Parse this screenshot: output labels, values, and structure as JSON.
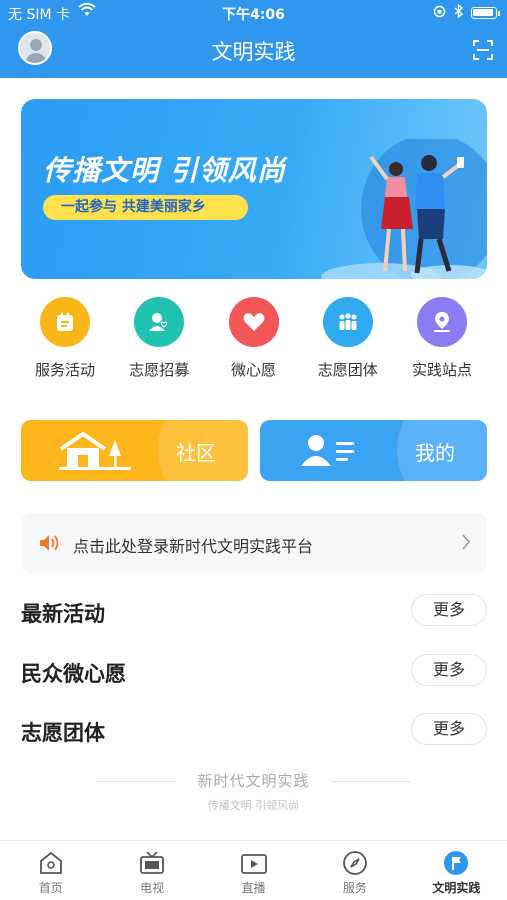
{
  "status_bar": {
    "carrier": "无 SIM 卡",
    "time": "下午4:06"
  },
  "header": {
    "title": "文明实践"
  },
  "banner": {
    "headline": "传播文明 引领风尚",
    "tagline": "一起参与 共建美丽家乡"
  },
  "quick_links": [
    {
      "label": "服务活动",
      "color": "#f9b619",
      "icon": "calendar-icon"
    },
    {
      "label": "志愿招募",
      "color": "#1fc3b0",
      "icon": "user-heart-icon"
    },
    {
      "label": "微心愿",
      "color": "#f25656",
      "icon": "heart-icon"
    },
    {
      "label": "志愿团体",
      "color": "#2fa9f0",
      "icon": "group-icon"
    },
    {
      "label": "实践站点",
      "color": "#8c7cf2",
      "icon": "location-icon"
    }
  ],
  "cards": {
    "community": "社区",
    "mine": "我的"
  },
  "notice": {
    "text": "点击此处登录新时代文明实践平台"
  },
  "sections": [
    {
      "title": "最新活动",
      "more": "更多"
    },
    {
      "title": "民众微心愿",
      "more": "更多"
    },
    {
      "title": "志愿团体",
      "more": "更多"
    }
  ],
  "slogan": {
    "title": "新时代文明实践",
    "subtitle": "传播文明 引领风尚"
  },
  "tabs": [
    {
      "label": "首页",
      "icon": "home-icon"
    },
    {
      "label": "电视",
      "icon": "tv-icon"
    },
    {
      "label": "直播",
      "icon": "live-icon"
    },
    {
      "label": "服务",
      "icon": "compass-icon"
    },
    {
      "label": "文明实践",
      "icon": "flag-icon",
      "active": true
    }
  ],
  "colors": {
    "primary": "#2f97ee",
    "community": "#fdb61a",
    "mine": "#3ba3f3"
  }
}
